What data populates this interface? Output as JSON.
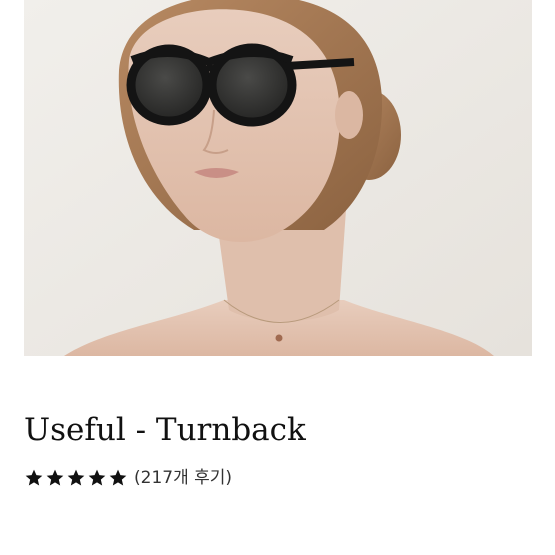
{
  "product": {
    "image_icon": "model-wearing-sunglasses-photo",
    "title": "Useful - Turnback",
    "rating": {
      "stars_filled": 5,
      "stars_total": 5,
      "star_color": "#111111",
      "review_label": "(217개 후기)"
    }
  },
  "colors": {
    "background": "#ffffff",
    "photo_backdrop": "#eeebe6",
    "text": "#111111"
  }
}
